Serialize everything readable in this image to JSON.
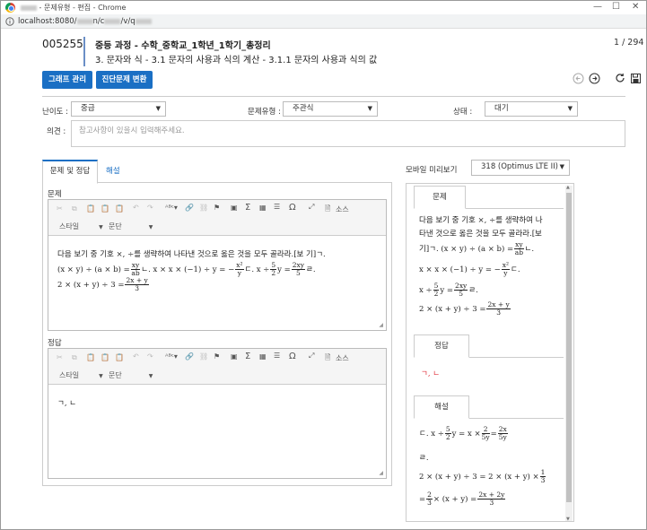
{
  "window": {
    "title": "- 문제유형 - 편집 - Chrome",
    "minimize": "—",
    "maximize": "☐",
    "close": "✕"
  },
  "address": {
    "url": "localhost:8080/",
    "url_tail": "n/c",
    "url_tail2": "/v/q"
  },
  "header": {
    "question_id": "005255",
    "title": "중등 과정 - 수학_중학교_1학년_1학기_총정리",
    "subtitle": "3. 문자와 식 - 3.1 문자의 사용과 식의 계산 - 3.1.1 문자의 사용과 식의 값",
    "page_counter": "1 / 294"
  },
  "toolbar": {
    "graph_button": "그래프 관리",
    "diagnostic_button": "진단문제 변환"
  },
  "icons": {
    "prev": "prev-circle-icon",
    "next": "next-circle-icon",
    "refresh": "refresh-icon",
    "save": "save-icon"
  },
  "form": {
    "difficulty": {
      "label": "난이도 :",
      "value": "중급"
    },
    "type": {
      "label": "문제유형 :",
      "value": "주관식"
    },
    "status": {
      "label": "상태 :",
      "value": "대기"
    },
    "opinion": {
      "label": "의견 :",
      "placeholder": "참고사항이 있을시 입력해주세요."
    }
  },
  "tabs": {
    "problem_answer": "문제 및 정답",
    "explanation": "해설"
  },
  "problem": {
    "label": "문제",
    "style_dropdown": "스타일",
    "paragraph_dropdown": "문단",
    "source_button": "소스",
    "line1": "다음 보기 중 기호 ×, ÷를 생략하여 나타낸 것으로 옳은 것을 모두 골라라.[보 기]ㄱ.",
    "line2_a": "(x × y) ÷ (a × b) =",
    "line2_frac_n": "xy",
    "line2_frac_d": "ab",
    "line2_b": "ㄴ. x × x × (−1) ÷ y = −",
    "line2_frac2_n": "x²",
    "line2_frac2_d": "y",
    "line2_c": "ㄷ. x ÷",
    "line2_frac3_n": "5",
    "line2_frac3_d": "2",
    "line2_d": "y =",
    "line2_frac4_n": "2xy",
    "line2_frac4_d": "5",
    "line2_e": "ㄹ.",
    "line3_a": "2 × (x + y) ÷ 3 =",
    "line3_frac_n": "2x + y",
    "line3_frac_d": "3"
  },
  "answer": {
    "label": "정답",
    "style_dropdown": "스타일",
    "paragraph_dropdown": "문단",
    "source_button": "소스",
    "value": "ㄱ, ㄴ"
  },
  "mobile": {
    "label": "모바일 미리보기",
    "device": "318 (Optimus LTE II)",
    "problem_tab": "문제",
    "answer_tab": "정답",
    "explanation_tab": "해설",
    "p1": "다음 보기 중 기호 ×, ÷를 생략하여 나",
    "p2": "타낸 것으로 옳은 것을 모두 골라라.[보",
    "p3a": "기]ㄱ. (x × y) ÷ (a × b) =",
    "p3n": "xy",
    "p3d": "ab",
    "p3b": "ㄴ.",
    "p4a": "x × x × (−1) ÷ y = −",
    "p4n": "x²",
    "p4d": "y",
    "p4b": "ㄷ.",
    "p5a": "x ÷",
    "p5n": "5",
    "p5d": "2",
    "p5b": "y =",
    "p5n2": "2xy",
    "p5d2": "5",
    "p5c": "ㄹ.",
    "p6a": "2 × (x + y) ÷ 3 =",
    "p6n": "2x + y",
    "p6d": "3",
    "answer_value": "ㄱ, ㄴ",
    "e1a": "ㄷ. x ÷",
    "e1n": "5",
    "e1d": "2",
    "e1b": "y = x ×",
    "e1n2": "2",
    "e1d2": "5y",
    "e1c": "=",
    "e1n3": "2x",
    "e1d3": "5y",
    "e2": "ㄹ.",
    "e3a": "2 × (x + y) ÷ 3 = 2 × (x + y) ×",
    "e3n": "1",
    "e3d": "3",
    "e4a": "=",
    "e4n": "2",
    "e4d": "3",
    "e4b": "× (x + y) =",
    "e4n2": "2x + 2y",
    "e4d2": "3"
  },
  "colors": {
    "accent": "#1a6fc4",
    "answer_red": "#e0323c"
  }
}
